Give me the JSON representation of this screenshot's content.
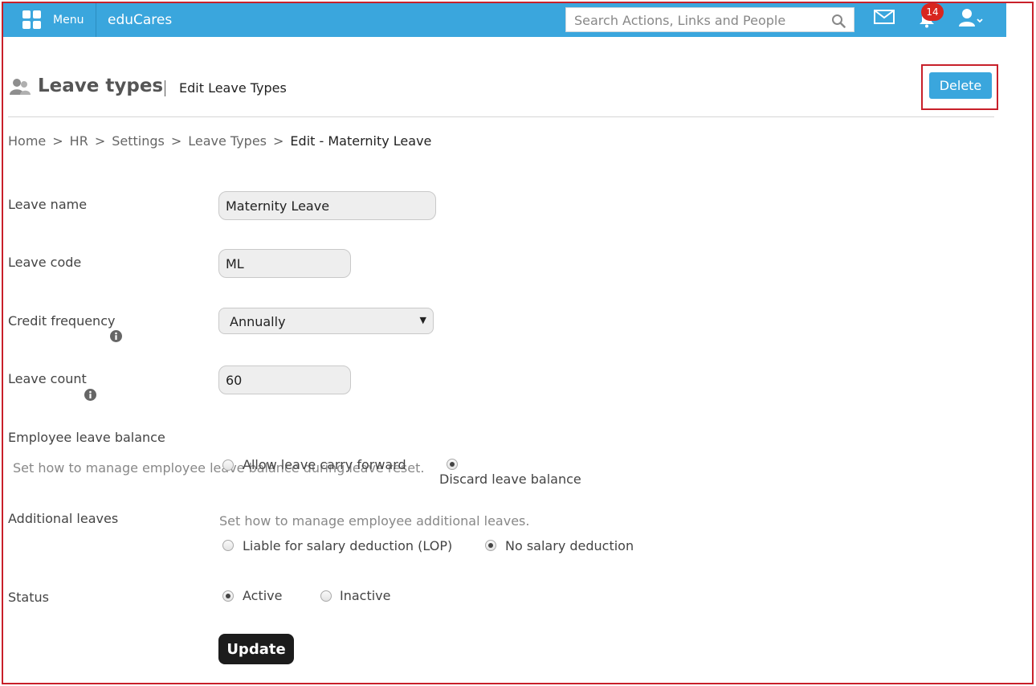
{
  "topbar": {
    "menu_label": "Menu",
    "brand": "eduCares",
    "search_placeholder": "Search Actions, Links and People",
    "notification_count": "14",
    "bar_color": "#3aa6dd"
  },
  "header": {
    "title": "Leave types",
    "subtitle": "Edit Leave Types",
    "delete_label": "Delete"
  },
  "breadcrumb": {
    "items": [
      "Home",
      "HR",
      "Settings",
      "Leave Types"
    ],
    "separator": ">",
    "current": "Edit - Maternity Leave"
  },
  "form": {
    "leave_name": {
      "label": "Leave name",
      "value": "Maternity Leave"
    },
    "leave_code": {
      "label": "Leave code",
      "value": "ML"
    },
    "credit_frequency": {
      "label": "Credit frequency",
      "selected": "Annually"
    },
    "leave_count": {
      "label": "Leave count",
      "value": "60"
    },
    "employee_leave_balance": {
      "label": "Employee leave balance",
      "hint": "Set how to manage employee leave balance during leave reset.",
      "options": [
        {
          "label": "Allow leave carry forward",
          "checked": false
        },
        {
          "label": "Discard leave balance",
          "checked": true
        }
      ]
    },
    "additional_leaves": {
      "label": "Additional leaves",
      "hint": "Set how to manage employee additional leaves.",
      "options": [
        {
          "label": "Liable for salary deduction (LOP)",
          "checked": false
        },
        {
          "label": "No salary deduction",
          "checked": true
        }
      ]
    },
    "status": {
      "label": "Status",
      "options": [
        {
          "label": "Active",
          "checked": true
        },
        {
          "label": "Inactive",
          "checked": false
        }
      ]
    },
    "update_label": "Update"
  }
}
